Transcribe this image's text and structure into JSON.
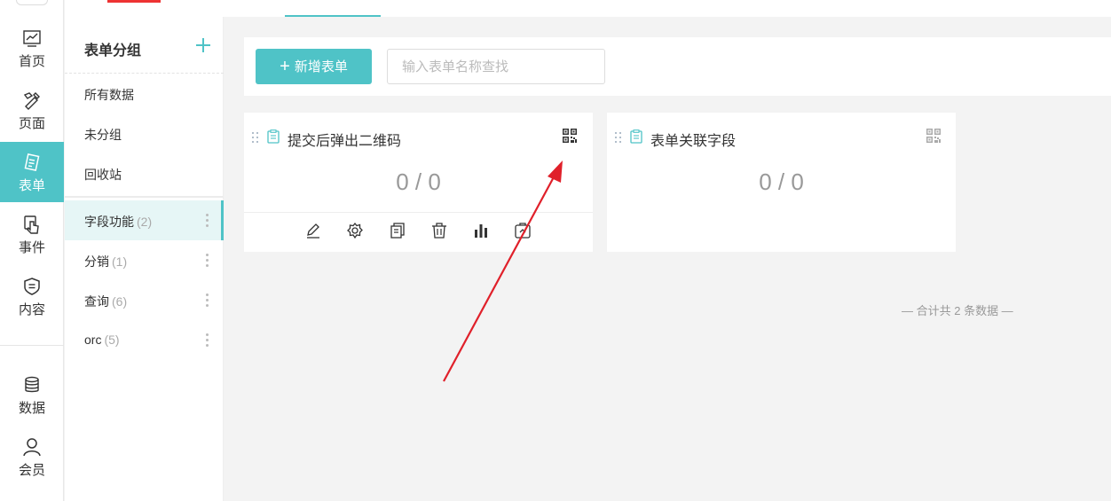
{
  "nav": {
    "items": [
      {
        "label": "首页",
        "icon": "chart-line-icon"
      },
      {
        "label": "页面",
        "icon": "design-tools-icon"
      },
      {
        "label": "表单",
        "icon": "form-edit-icon",
        "active": true
      },
      {
        "label": "事件",
        "icon": "hand-pointer-icon"
      },
      {
        "label": "内容",
        "icon": "shield-doc-icon"
      },
      {
        "label": "数据",
        "icon": "database-icon"
      },
      {
        "label": "会员",
        "icon": "user-icon"
      }
    ]
  },
  "groups": {
    "title": "表单分组",
    "links": [
      "所有数据",
      "未分组",
      "回收站"
    ],
    "items": [
      {
        "name": "字段功能",
        "count": "(2)",
        "active": true
      },
      {
        "name": "分销",
        "count": "(1)"
      },
      {
        "name": "查询",
        "count": "(6)"
      },
      {
        "name": "orc",
        "count": "(5)"
      }
    ]
  },
  "toolbar": {
    "add_label": "新增表单",
    "search_placeholder": "输入表单名称查找"
  },
  "cards": [
    {
      "title": "提交后弹出二维码",
      "stat": "0 / 0",
      "qr_color": "#333333"
    },
    {
      "title": "表单关联字段",
      "stat": "0 / 0",
      "qr_color": "#aaaaaa"
    }
  ],
  "footer": {
    "total": "— 合计共 2 条数据 —"
  },
  "colors": {
    "accent": "#4fc3c7",
    "annotation": "#e0202a"
  }
}
